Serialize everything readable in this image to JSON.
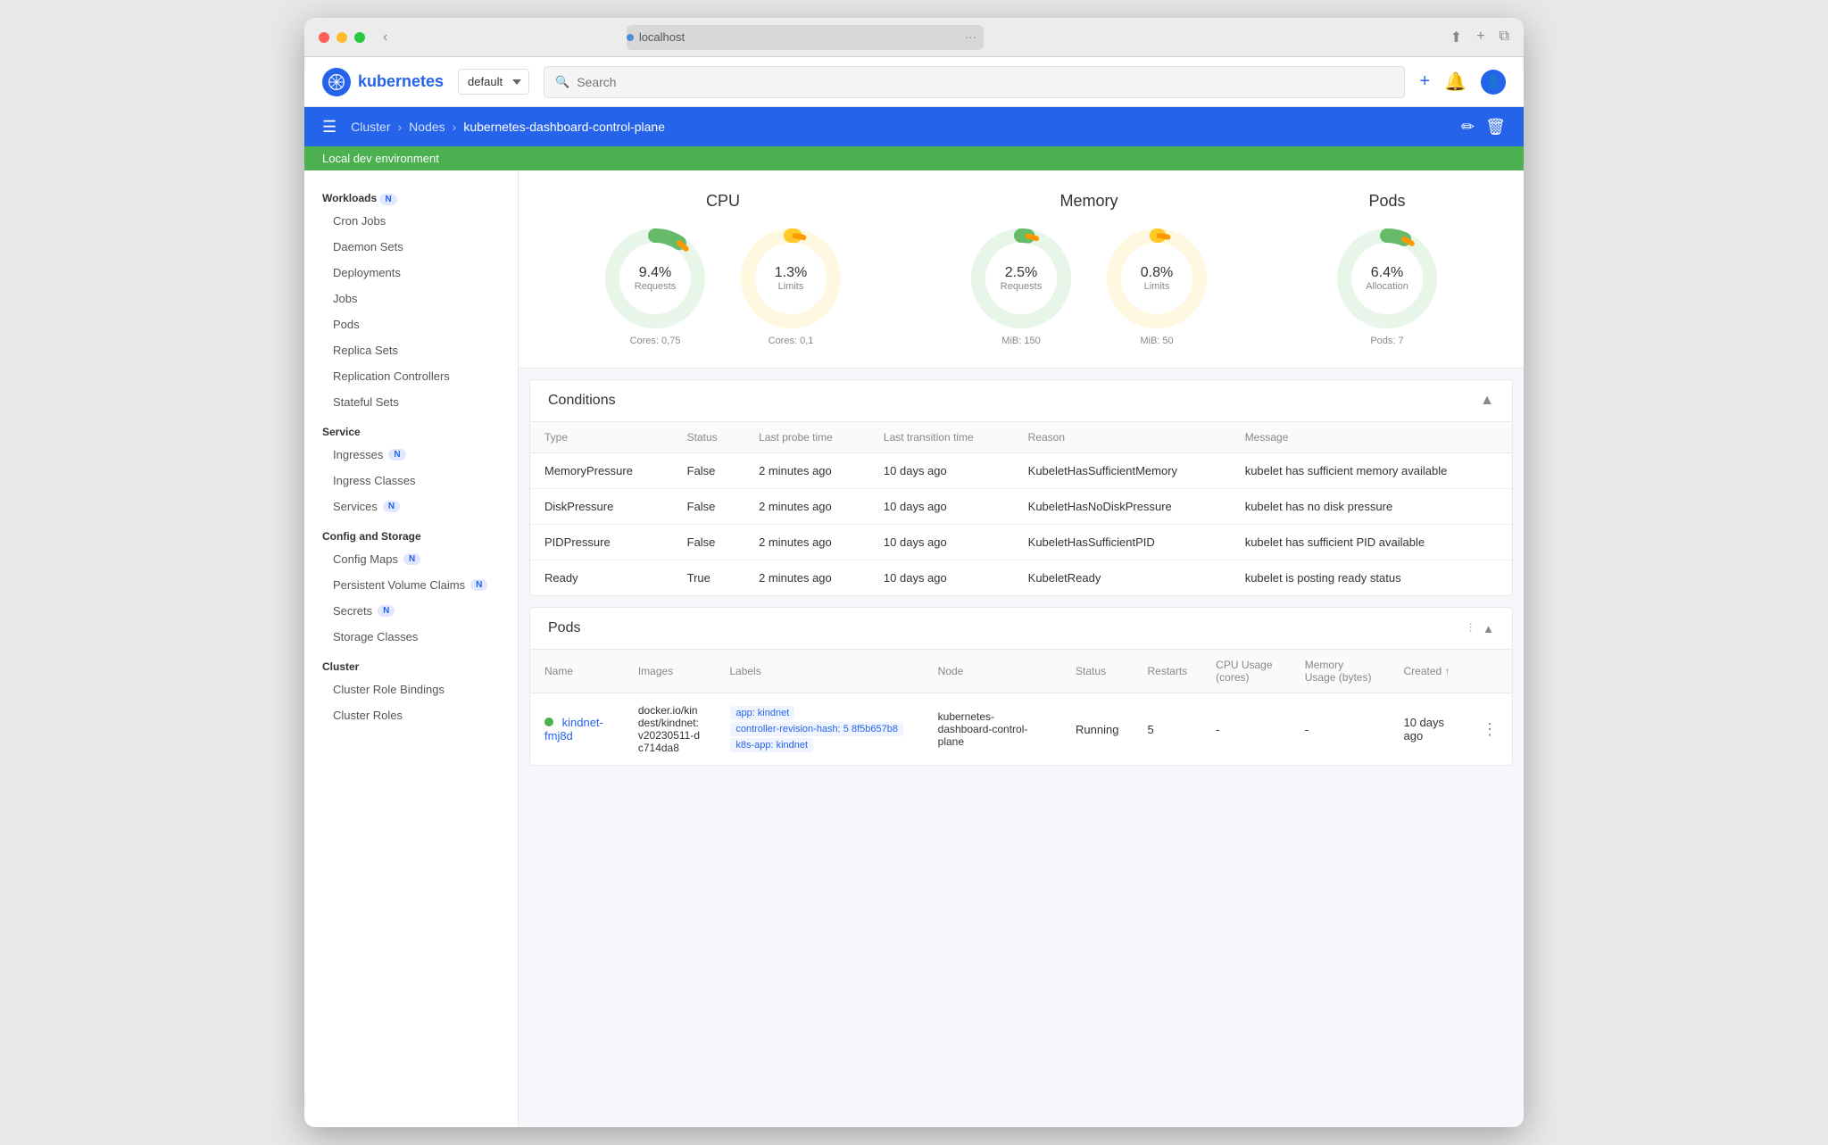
{
  "window": {
    "url": "localhost"
  },
  "topnav": {
    "logo": "kubernetes",
    "namespace": "default",
    "search_placeholder": "Search",
    "add_icon": "+",
    "bell_icon": "🔔",
    "user_icon": "👤"
  },
  "breadcrumb": {
    "cluster": "Cluster",
    "nodes": "Nodes",
    "current": "kubernetes-dashboard-control-plane",
    "env": "Local dev environment"
  },
  "charts": {
    "cpu_title": "CPU",
    "memory_title": "Memory",
    "pods_title": "Pods",
    "cpu_requests_pct": "9.4%",
    "cpu_requests_label": "Requests",
    "cpu_requests_footer": "Cores: 0,75",
    "cpu_limits_pct": "1.3%",
    "cpu_limits_label": "Limits",
    "cpu_limits_footer": "Cores: 0,1",
    "mem_requests_pct": "2.5%",
    "mem_requests_label": "Requests",
    "mem_requests_footer": "MiB: 150",
    "mem_limits_pct": "0.8%",
    "mem_limits_label": "Limits",
    "mem_limits_footer": "MiB: 50",
    "pods_pct": "6.4%",
    "pods_label": "Allocation",
    "pods_footer": "Pods: 7"
  },
  "conditions": {
    "title": "Conditions",
    "columns": [
      "Type",
      "Status",
      "Last probe time",
      "Last transition time",
      "Reason",
      "Message"
    ],
    "rows": [
      {
        "type": "MemoryPressure",
        "status": "False",
        "last_probe": "2 minutes ago",
        "last_transition": "10 days ago",
        "reason": "KubeletHasSufficientMemory",
        "message": "kubelet has sufficient memory available"
      },
      {
        "type": "DiskPressure",
        "status": "False",
        "last_probe": "2 minutes ago",
        "last_transition": "10 days ago",
        "reason": "KubeletHasNoDiskPressure",
        "message": "kubelet has no disk pressure"
      },
      {
        "type": "PIDPressure",
        "status": "False",
        "last_probe": "2 minutes ago",
        "last_transition": "10 days ago",
        "reason": "KubeletHasSufficientPID",
        "message": "kubelet has sufficient PID available"
      },
      {
        "type": "Ready",
        "status": "True",
        "last_probe": "2 minutes ago",
        "last_transition": "10 days ago",
        "reason": "KubeletReady",
        "message": "kubelet is posting ready status"
      }
    ]
  },
  "pods": {
    "title": "Pods",
    "columns": [
      "Name",
      "Images",
      "Labels",
      "Node",
      "Status",
      "Restarts",
      "CPU Usage (cores)",
      "Memory Usage (bytes)",
      "Created ↑"
    ],
    "rows": [
      {
        "status_color": "#4caf50",
        "name": "kindnet-fmj8d",
        "image": "docker.io/kindest/kindnet:v20230511-dc714da8",
        "labels": [
          "app: kindnet",
          "controller-revision-hash: 5 8f5b657b8",
          "k8s-app: kindnet"
        ],
        "node": "kubernetes-dashboard-control-plane",
        "status": "Running",
        "restarts": "5",
        "cpu": "-",
        "memory": "-",
        "created": "10 days ago"
      }
    ]
  },
  "sidebar": {
    "workloads_label": "Workloads",
    "workloads_badge": "N",
    "cron_jobs": "Cron Jobs",
    "daemon_sets": "Daemon Sets",
    "deployments": "Deployments",
    "jobs": "Jobs",
    "pods": "Pods",
    "replica_sets": "Replica Sets",
    "replication_controllers": "Replication Controllers",
    "stateful_sets": "Stateful Sets",
    "service_label": "Service",
    "ingresses": "Ingresses",
    "ingresses_badge": "N",
    "ingress_classes": "Ingress Classes",
    "services": "Services",
    "services_badge": "N",
    "config_storage_label": "Config and Storage",
    "config_maps": "Config Maps",
    "config_maps_badge": "N",
    "persistent_volume_claims": "Persistent Volume Claims",
    "persistent_badge": "N",
    "secrets": "Secrets",
    "secrets_badge": "N",
    "storage_classes": "Storage Classes",
    "cluster_label": "Cluster",
    "cluster_role_bindings": "Cluster Role Bindings",
    "cluster_roles": "Cluster Roles"
  }
}
